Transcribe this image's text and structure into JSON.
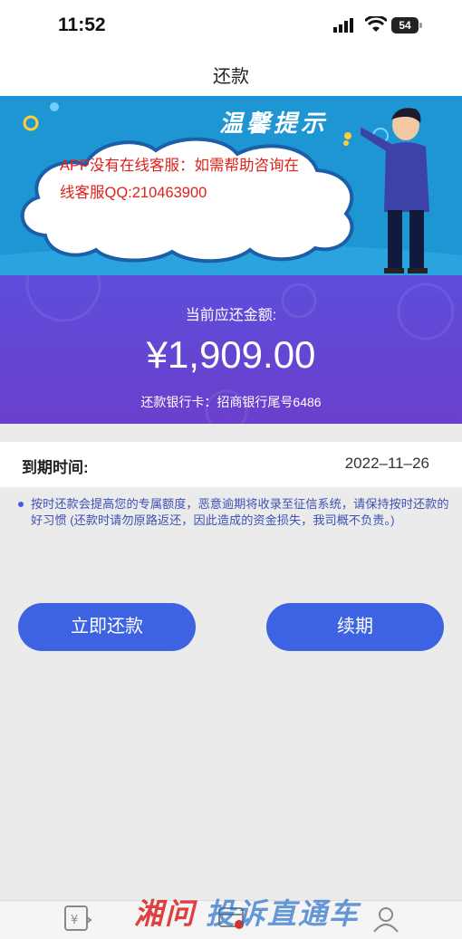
{
  "status_bar": {
    "time": "11:52",
    "battery": "54"
  },
  "nav": {
    "title": "还款"
  },
  "banner": {
    "title": "温馨提示",
    "notice_line1": "APP没有在线客服：如需帮助咨询在",
    "notice_line2": "线客服QQ:210463900"
  },
  "amount_card": {
    "label": "当前应还金额:",
    "amount": "¥1,909.00",
    "bank": "还款银行卡：招商银行尾号6486"
  },
  "due": {
    "label": "到期时间:",
    "value": "2022–11–26"
  },
  "tip": "按时还款会提高您的专属额度，恶意逾期将收录至征信系统，请保持按时还款的好习惯 (还款时请勿原路返还，因此造成的资金损失，我司概不负责。)",
  "actions": {
    "repay": "立即还款",
    "renew": "续期"
  },
  "watermark": {
    "part1": "湘问",
    "part2": "投诉直通车"
  },
  "colors": {
    "accent": "#3d63e3",
    "banner": "#1e96d4",
    "card": "#5e4ddb",
    "notice": "#e0201a"
  },
  "tabbar": {
    "icons": [
      "yen-icon",
      "card-icon",
      "user-icon"
    ]
  }
}
